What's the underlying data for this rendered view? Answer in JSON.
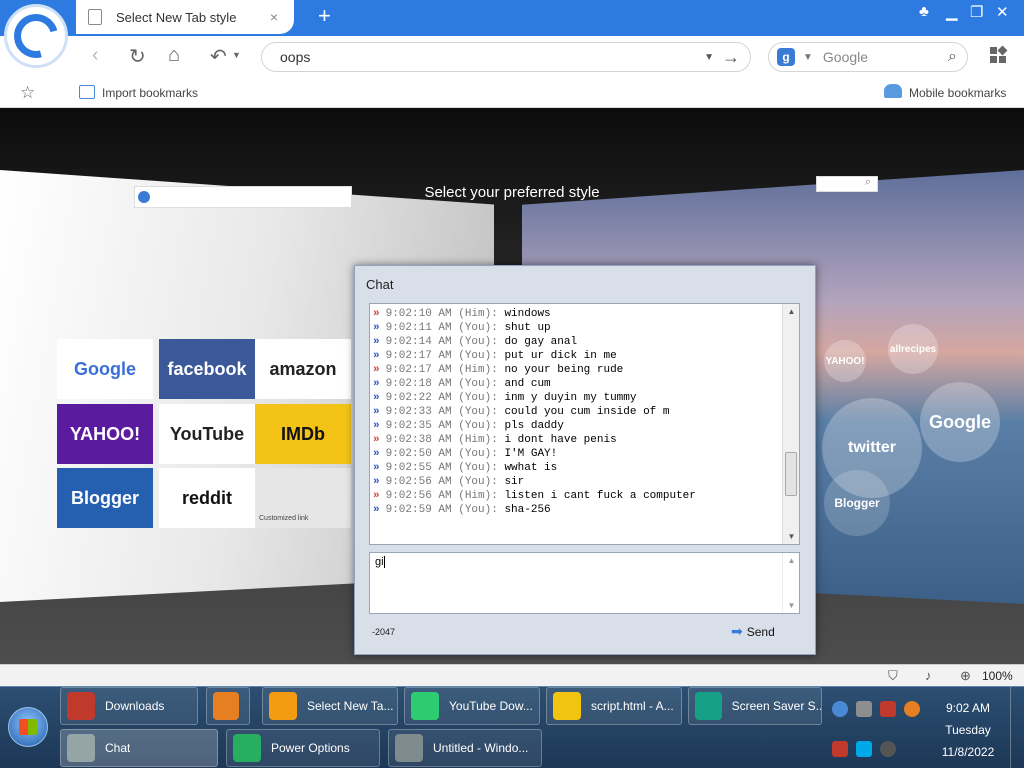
{
  "browser": {
    "tab_title": "Select New Tab style",
    "tab_close": "×",
    "new_tab": "+",
    "address": "oops",
    "search_provider": "Google",
    "import_bookmarks": "Import bookmarks",
    "mobile_bookmarks": "Mobile bookmarks",
    "zoom": "100%"
  },
  "page": {
    "heading": "Select your preferred style",
    "left_tiles": [
      {
        "label": "Google",
        "bg": "#ffffff",
        "fg": "#3a6fd8"
      },
      {
        "label": "facebook",
        "bg": "#3b5998",
        "fg": "#ffffff"
      },
      {
        "label": "amazon",
        "bg": "#ffffff",
        "fg": "#222222"
      },
      {
        "label": "YAHOO!",
        "bg": "#5b1b9e",
        "fg": "#ffffff"
      },
      {
        "label": "YouTube",
        "bg": "#ffffff",
        "fg": "#222222"
      },
      {
        "label": "IMDb",
        "bg": "#f3c315",
        "fg": "#111111"
      },
      {
        "label": "Blogger",
        "bg": "#2560b0",
        "fg": "#ffffff"
      },
      {
        "label": "reddit",
        "bg": "#ffffff",
        "fg": "#111111"
      },
      {
        "label": "Customized link",
        "bg": "#e6e6e6",
        "fg": "#444444"
      }
    ],
    "right_bubbles": [
      {
        "label": "YAHOO!"
      },
      {
        "label": "allrecipes"
      },
      {
        "label": "Google"
      },
      {
        "label": "twitter"
      },
      {
        "label": "Blogger"
      }
    ]
  },
  "chat": {
    "title": "Chat",
    "lines": [
      {
        "dir": "him",
        "time": "9:02:10 AM",
        "who": "(Him):",
        "msg": "windows"
      },
      {
        "dir": "you",
        "time": "9:02:11 AM",
        "who": "(You):",
        "msg": "shut up"
      },
      {
        "dir": "you",
        "time": "9:02:14 AM",
        "who": "(You):",
        "msg": "do gay anal"
      },
      {
        "dir": "you",
        "time": "9:02:17 AM",
        "who": "(You):",
        "msg": "put ur dick in me"
      },
      {
        "dir": "him",
        "time": "9:02:17 AM",
        "who": "(Him):",
        "msg": "no your being rude"
      },
      {
        "dir": "you",
        "time": "9:02:18 AM",
        "who": "(You):",
        "msg": "and cum"
      },
      {
        "dir": "you",
        "time": "9:02:22 AM",
        "who": "(You):",
        "msg": "inm y duyin my tummy"
      },
      {
        "dir": "you",
        "time": "9:02:33 AM",
        "who": "(You):",
        "msg": "could you cum inside of m"
      },
      {
        "dir": "you",
        "time": "9:02:35 AM",
        "who": "(You):",
        "msg": "pls daddy"
      },
      {
        "dir": "him",
        "time": "9:02:38 AM",
        "who": "(Him):",
        "msg": "i dont have penis"
      },
      {
        "dir": "you",
        "time": "9:02:50 AM",
        "who": "(You):",
        "msg": "I'M GAY!"
      },
      {
        "dir": "you",
        "time": "9:02:55 AM",
        "who": "(You):",
        "msg": "wwhat is"
      },
      {
        "dir": "you",
        "time": "9:02:56 AM",
        "who": "(You):",
        "msg": "sir"
      },
      {
        "dir": "him",
        "time": "9:02:56 AM",
        "who": "(Him):",
        "msg": "listen i cant fuck a computer"
      },
      {
        "dir": "you",
        "time": "9:02:59 AM",
        "who": "(You):",
        "msg": "sha-256"
      }
    ],
    "input_value": "gi",
    "counter": "-2047",
    "send_label": "Send"
  },
  "taskbar": {
    "row1": [
      {
        "label": "Downloads",
        "color": "#c0392b"
      },
      {
        "label": "",
        "color": "#e67e22"
      },
      {
        "label": "Select New Ta...",
        "color": "#f39c12"
      },
      {
        "label": "YouTube Dow...",
        "color": "#2ecc71"
      },
      {
        "label": "script.html - A...",
        "color": "#f1c40f"
      },
      {
        "label": "Screen Saver S...",
        "color": "#16a085"
      }
    ],
    "row2": [
      {
        "label": "Chat",
        "color": "#95a5a6"
      },
      {
        "label": "Power Options",
        "color": "#27ae60"
      },
      {
        "label": "Untitled - Windo...",
        "color": "#7f8c8d"
      }
    ],
    "clock_time": "9:02 AM",
    "clock_day": "Tuesday",
    "clock_date": "11/8/2022"
  }
}
